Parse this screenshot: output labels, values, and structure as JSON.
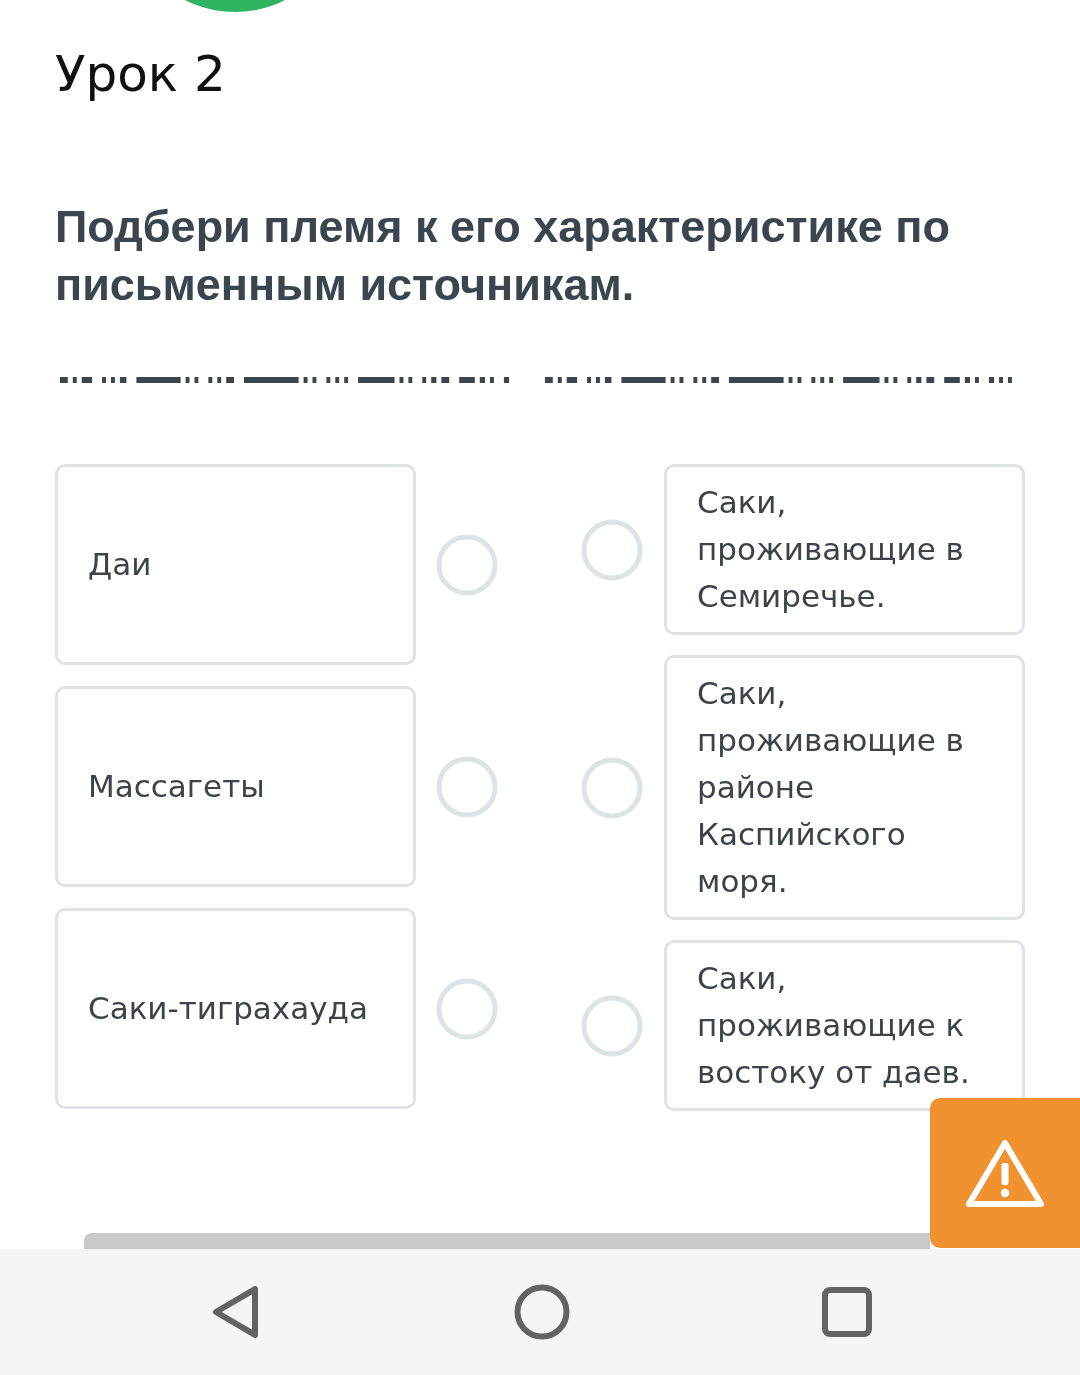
{
  "header": {
    "title": "Урок 2"
  },
  "task": {
    "question": "Подбери племя к его характеристике по письменным источникам."
  },
  "left_items": [
    {
      "text": "Даи",
      "selected": false
    },
    {
      "text": "Массагеты",
      "selected": false
    },
    {
      "text": "Саки-тиграхауда",
      "selected": false
    }
  ],
  "right_items": [
    {
      "text": "Саки, проживающие в Семиречье.",
      "selected": false
    },
    {
      "text": "Саки, проживающие в районе Каспийского моря.",
      "selected": false
    },
    {
      "text": "Саки, проживающие к востоку от даев.",
      "selected": false
    }
  ]
}
